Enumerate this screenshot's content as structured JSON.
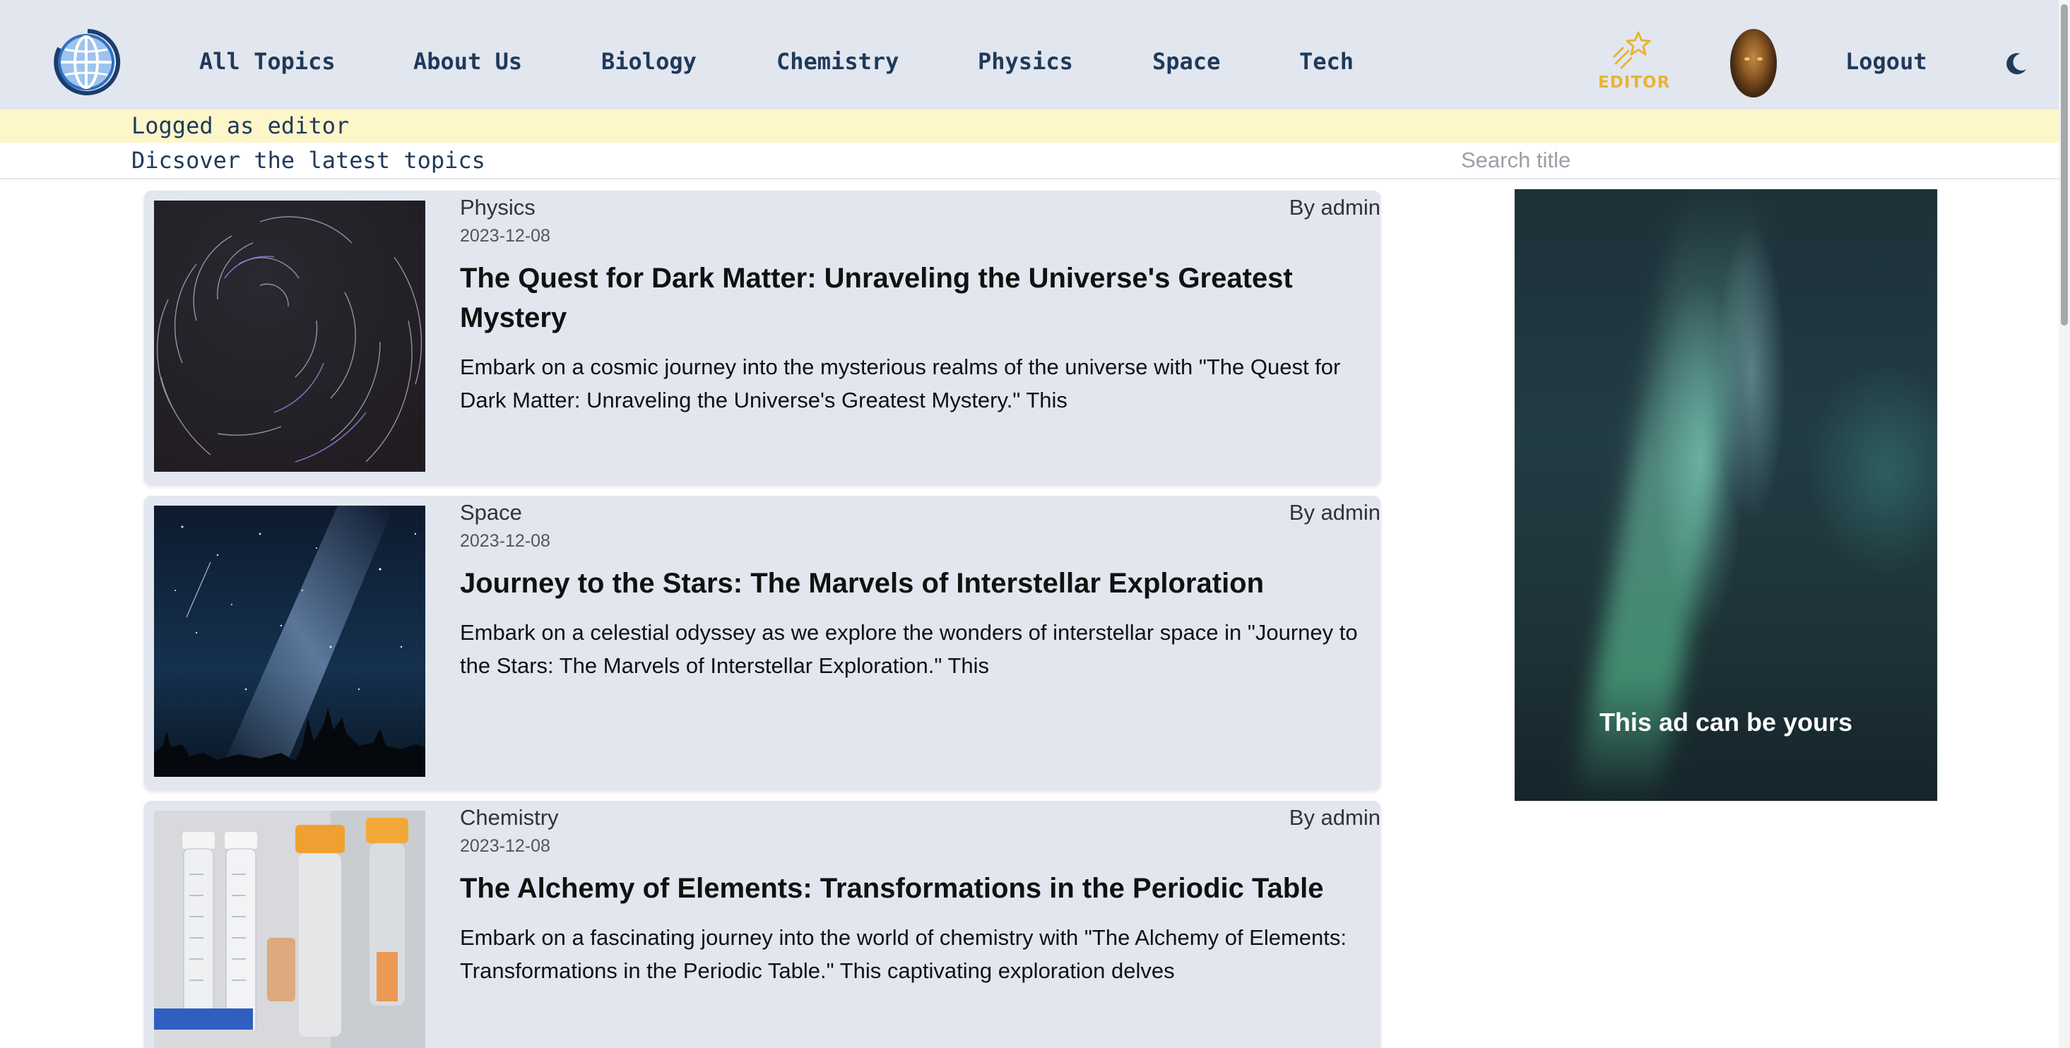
{
  "header": {
    "nav": [
      {
        "label": "All Topics"
      },
      {
        "label": "About Us"
      },
      {
        "label": "Biology"
      },
      {
        "label": "Chemistry"
      },
      {
        "label": "Physics"
      },
      {
        "label": "Space"
      },
      {
        "label": "Tech"
      }
    ],
    "editor_label": "EDITOR",
    "logout_label": "Logout",
    "icons": {
      "logo": "globe-logo",
      "editor": "stars-icon",
      "theme": "moon-icon"
    },
    "colors": {
      "header_bg": "#e2e6ef",
      "nav_text": "#1f3a5a",
      "editor_accent": "#e8b432"
    }
  },
  "editor_bar": {
    "text": "Logged as editor",
    "color": "#fdf6c9"
  },
  "subheader": {
    "tagline": "Dicsover the latest topics",
    "search_placeholder": "Search title"
  },
  "articles": [
    {
      "category": "Physics",
      "author": "By admin",
      "date": "2023-12-08",
      "title": "The Quest for Dark Matter: Unraveling the Universe's Greatest Mystery",
      "excerpt": "Embark on a cosmic journey into the mysterious realms of the universe with \"The Quest for Dark Matter: Unraveling the Universe's Greatest Mystery.\" This",
      "image": "star-trails-photo"
    },
    {
      "category": "Space",
      "author": "By admin",
      "date": "2023-12-08",
      "title": "Journey to the Stars: The Marvels of Interstellar Exploration",
      "excerpt": "Embark on a celestial odyssey as we explore the wonders of interstellar space in \"Journey to the Stars: The Marvels of Interstellar Exploration.\" This",
      "image": "milky-way-photo"
    },
    {
      "category": "Chemistry",
      "author": "By admin",
      "date": "2023-12-08",
      "title": "The Alchemy of Elements: Transformations in the Periodic Table",
      "excerpt": "Embark on a fascinating journey into the world of chemistry with \"The Alchemy of Elements: Transformations in the Periodic Table.\" This captivating exploration delves",
      "image": "test-tubes-photo"
    }
  ],
  "ad": {
    "text": "This ad can be yours",
    "image": "aurora-photo"
  }
}
